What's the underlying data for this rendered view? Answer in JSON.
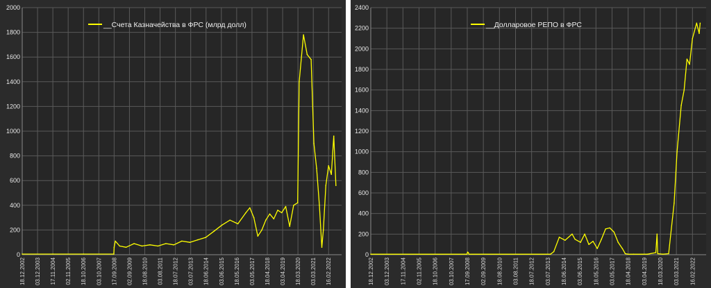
{
  "chart_data": [
    {
      "type": "line",
      "series": [
        {
          "name": "__Счета Казначейства в ФРС (млрд долл)",
          "color": "#ffff00",
          "x": [
            "2002-12-18",
            "2004-11-17",
            "2006-10-18",
            "2008-09-10",
            "2008-09-17",
            "2008-10-15",
            "2009-01-21",
            "2009-06-17",
            "2009-12-16",
            "2010-06-16",
            "2010-12-15",
            "2011-06-15",
            "2011-12-14",
            "2012-06-13",
            "2012-12-12",
            "2013-06-12",
            "2013-12-11",
            "2014-06-11",
            "2014-12-17",
            "2015-06-17",
            "2015-12-16",
            "2016-06-15",
            "2016-12-14",
            "2017-03-15",
            "2017-06-14",
            "2017-09-13",
            "2017-12-13",
            "2018-03-14",
            "2018-06-13",
            "2018-09-12",
            "2018-12-12",
            "2019-03-13",
            "2019-06-12",
            "2019-09-11",
            "2019-12-11",
            "2020-03-11",
            "2020-04-15",
            "2020-07-22",
            "2020-10-14",
            "2021-01-13",
            "2021-03-17",
            "2021-05-19",
            "2021-07-21",
            "2021-09-15",
            "2021-10-20",
            "2021-12-15",
            "2022-02-16",
            "2022-04-20",
            "2022-06-15",
            "2022-08-03"
          ],
          "y": [
            5,
            5,
            5,
            5,
            60,
            110,
            70,
            60,
            90,
            70,
            80,
            70,
            90,
            80,
            110,
            100,
            120,
            140,
            190,
            240,
            280,
            250,
            340,
            380,
            300,
            150,
            200,
            280,
            330,
            290,
            360,
            340,
            390,
            230,
            400,
            420,
            1400,
            1780,
            1620,
            1580,
            900,
            700,
            400,
            60,
            200,
            560,
            720,
            650,
            960,
            560
          ]
        }
      ],
      "xlabel": "",
      "ylabel": "",
      "ylim": [
        0,
        2000
      ],
      "yticks": [
        0,
        200,
        400,
        600,
        800,
        1000,
        1200,
        1400,
        1600,
        1800,
        2000
      ],
      "xticks": [
        "18.12.2002",
        "03.12.2003",
        "17.11.2004",
        "02.11.2005",
        "18.10.2006",
        "03.10.2007",
        "17.09.2008",
        "02.09.2009",
        "18.08.2010",
        "03.08.2011",
        "18.07.2012",
        "03.07.2013",
        "18.06.2014",
        "03.06.2015",
        "18.05.2016",
        "03.05.2017",
        "18.04.2018",
        "03.04.2019",
        "18.03.2020",
        "03.03.2021",
        "16.02.2022"
      ],
      "grid": true,
      "legend": "top-center"
    },
    {
      "type": "line",
      "series": [
        {
          "name": "__Долларовое РЕПО в ФРС",
          "color": "#ffff00",
          "x": [
            "2002-12-18",
            "2008-09-10",
            "2008-09-24",
            "2008-10-08",
            "2008-10-22",
            "2013-09-01",
            "2013-11-13",
            "2014-03-12",
            "2014-07-16",
            "2014-12-17",
            "2015-02-18",
            "2015-06-17",
            "2015-09-16",
            "2015-12-16",
            "2016-03-16",
            "2016-06-15",
            "2016-09-14",
            "2016-12-14",
            "2017-03-15",
            "2017-06-14",
            "2017-09-13",
            "2017-12-13",
            "2018-02-14",
            "2018-04-18",
            "2018-08-15",
            "2019-06-12",
            "2019-12-11",
            "2020-01-08",
            "2020-01-22",
            "2020-05-13",
            "2020-09-16",
            "2021-01-13",
            "2021-03-17",
            "2021-06-16",
            "2021-08-18",
            "2021-10-20",
            "2021-12-15",
            "2022-02-16",
            "2022-05-18",
            "2022-07-13",
            "2022-08-03"
          ],
          "y": [
            5,
            5,
            25,
            20,
            5,
            5,
            30,
            170,
            140,
            200,
            150,
            120,
            200,
            100,
            130,
            60,
            150,
            250,
            260,
            220,
            120,
            60,
            10,
            5,
            5,
            5,
            20,
            200,
            10,
            5,
            10,
            500,
            1000,
            1450,
            1600,
            1900,
            1850,
            2100,
            2250,
            2150,
            2250
          ]
        }
      ],
      "xlabel": "",
      "ylabel": "",
      "ylim": [
        0,
        2400
      ],
      "yticks": [
        0,
        200,
        400,
        600,
        800,
        1000,
        1200,
        1400,
        1600,
        1800,
        2000,
        2200,
        2400
      ],
      "xticks": [
        "18.12.2002",
        "03.12.2003",
        "17.11.2004",
        "02.11.2005",
        "18.10.2006",
        "03.10.2007",
        "17.09.2008",
        "02.09.2009",
        "18.08.2010",
        "03.08.2011",
        "18.07.2012",
        "03.07.2013",
        "18.06.2014",
        "03.06.2015",
        "18.05.2016",
        "03.05.2017",
        "18.04.2018",
        "03.04.2019",
        "18.03.2020",
        "03.03.2021",
        "16.02.2022"
      ],
      "grid": true,
      "legend": "top-center"
    }
  ]
}
